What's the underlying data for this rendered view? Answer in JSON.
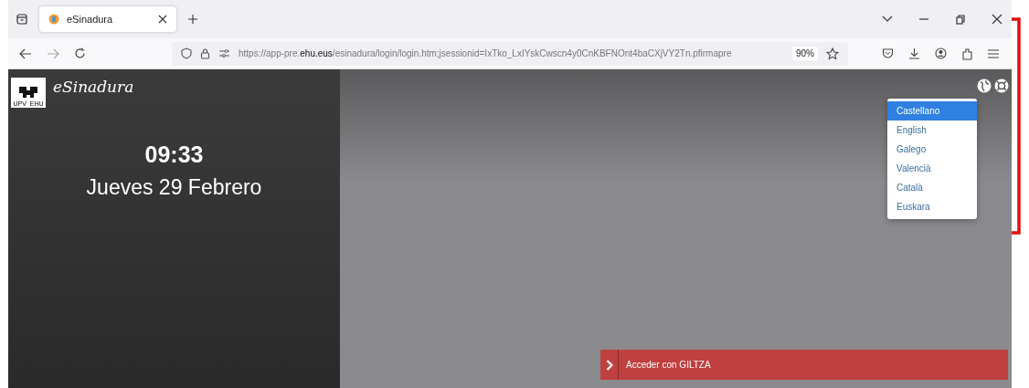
{
  "browser": {
    "tab": {
      "title": "eSinadura",
      "selected": true
    },
    "url": "https://app-pre.**ehu.eus**/esinadura/login/login.htm;jsessionid=IxTko_LxIYskCwscn4y0CnKBFNOnt4baCXjVY2Tn.pfirmapre",
    "zoom": "90%"
  },
  "sidebar": {
    "logo_text": "UPV  EHU",
    "app_name": "eSinadura",
    "time": "09:33",
    "date": "Jueves 29 Febrero"
  },
  "language_menu": [
    {
      "label": "Castellano",
      "selected": true
    },
    {
      "label": "English",
      "selected": false
    },
    {
      "label": "Galego",
      "selected": false
    },
    {
      "label": "Valencià",
      "selected": false
    },
    {
      "label": "Català",
      "selected": false
    },
    {
      "label": "Euskara",
      "selected": false
    }
  ],
  "login_button": {
    "label": "Acceder con GILTZA"
  }
}
